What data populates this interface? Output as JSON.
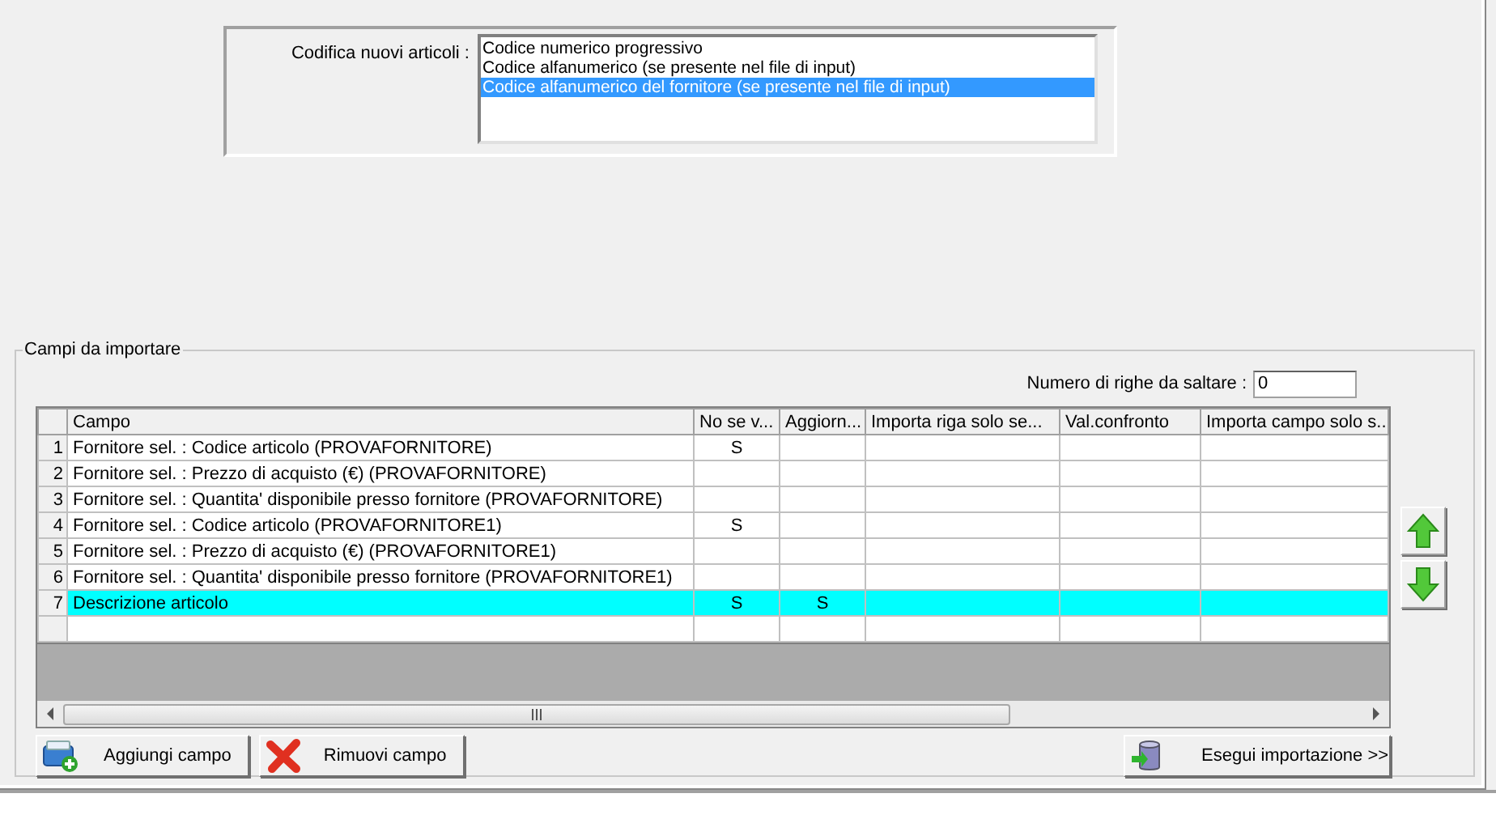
{
  "coding": {
    "label": "Codifica nuovi articoli :",
    "options": [
      {
        "label": "Codice numerico progressivo",
        "selected": false
      },
      {
        "label": "Codice alfanumerico (se presente nel file di input)",
        "selected": false
      },
      {
        "label": "Codice alfanumerico del fornitore (se presente nel file di input)",
        "selected": true
      }
    ]
  },
  "fields_group": {
    "title": "Campi da importare",
    "skip_rows": {
      "label": "Numero di righe da saltare  :",
      "value": "0"
    },
    "table": {
      "columns": [
        "Campo",
        "No se v...",
        "Aggiorn...",
        "Importa riga solo se...",
        "Val.confronto",
        "Importa campo solo s..."
      ],
      "rows": [
        {
          "number": "1",
          "campo": "Fornitore sel. : Codice articolo (PROVAFORNITORE)",
          "no_se_v": "S",
          "selected": false
        },
        {
          "number": "2",
          "campo": "Fornitore sel. : Prezzo di acquisto (€) (PROVAFORNITORE)",
          "selected": false
        },
        {
          "number": "3",
          "campo": "Fornitore sel. : Quantita' disponibile presso fornitore (PROVAFORNITORE)",
          "selected": false
        },
        {
          "number": "4",
          "campo": "Fornitore sel. : Codice articolo (PROVAFORNITORE1)",
          "no_se_v": "S",
          "selected": false
        },
        {
          "number": "5",
          "campo": "Fornitore sel. : Prezzo di acquisto (€) (PROVAFORNITORE1)",
          "selected": false
        },
        {
          "number": "6",
          "campo": "Fornitore sel. : Quantita' disponibile presso fornitore (PROVAFORNITORE1)",
          "selected": false
        },
        {
          "number": "7",
          "campo": "Descrizione articolo",
          "no_se_v": "S",
          "aggiorn": "S",
          "selected": true
        }
      ]
    }
  },
  "buttons": [
    {
      "kind": "add",
      "label": "Aggiungi campo"
    },
    {
      "kind": "remove",
      "label": "Rimuovi campo"
    },
    {
      "kind": "run",
      "label": "Esegui importazione >>"
    }
  ]
}
